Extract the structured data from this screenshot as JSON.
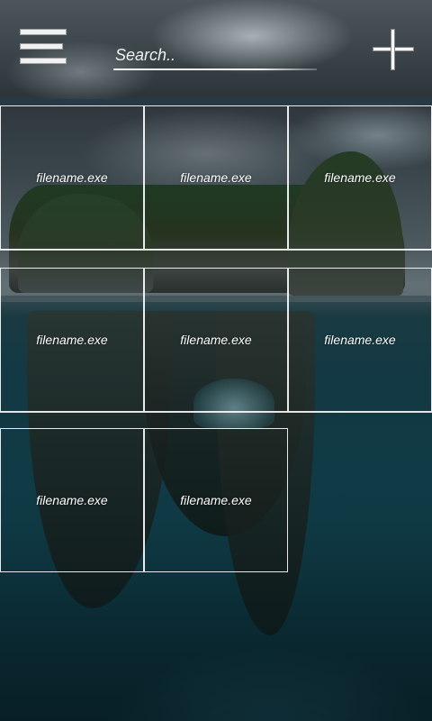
{
  "header": {
    "search_placeholder": "Search.."
  },
  "files": [
    {
      "name": "filename.exe"
    },
    {
      "name": "filename.exe"
    },
    {
      "name": "filename.exe"
    },
    {
      "name": "filename.exe"
    },
    {
      "name": "filename.exe"
    },
    {
      "name": "filename.exe"
    },
    {
      "name": "filename.exe"
    },
    {
      "name": "filename.exe"
    }
  ],
  "icons": {
    "menu": "hamburger-menu-icon",
    "add": "plus-icon"
  },
  "colors": {
    "text": "#ffffff",
    "sea": "#0f3a45",
    "sky": "#3a464c"
  }
}
